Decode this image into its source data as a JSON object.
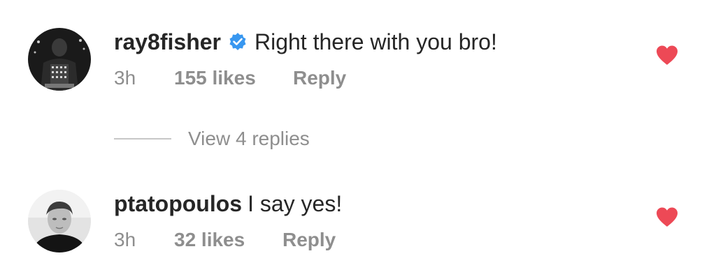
{
  "colors": {
    "text": "#262626",
    "muted": "#8e8e8e",
    "heart": "#ed4956",
    "verified": "#3897f0",
    "divider": "#c7c7c7"
  },
  "comments": [
    {
      "username": "ray8fisher",
      "verified": true,
      "text": "Right there with you bro!",
      "time": "3h",
      "likes": "155 likes",
      "reply_label": "Reply",
      "liked": true,
      "avatar_icon": "user-avatar-photo"
    },
    {
      "username": "ptatopoulos",
      "verified": false,
      "text": "I say yes!",
      "time": "3h",
      "likes": "32 likes",
      "reply_label": "Reply",
      "liked": true,
      "avatar_icon": "user-avatar-photo"
    }
  ],
  "view_replies_label": "View 4 replies"
}
